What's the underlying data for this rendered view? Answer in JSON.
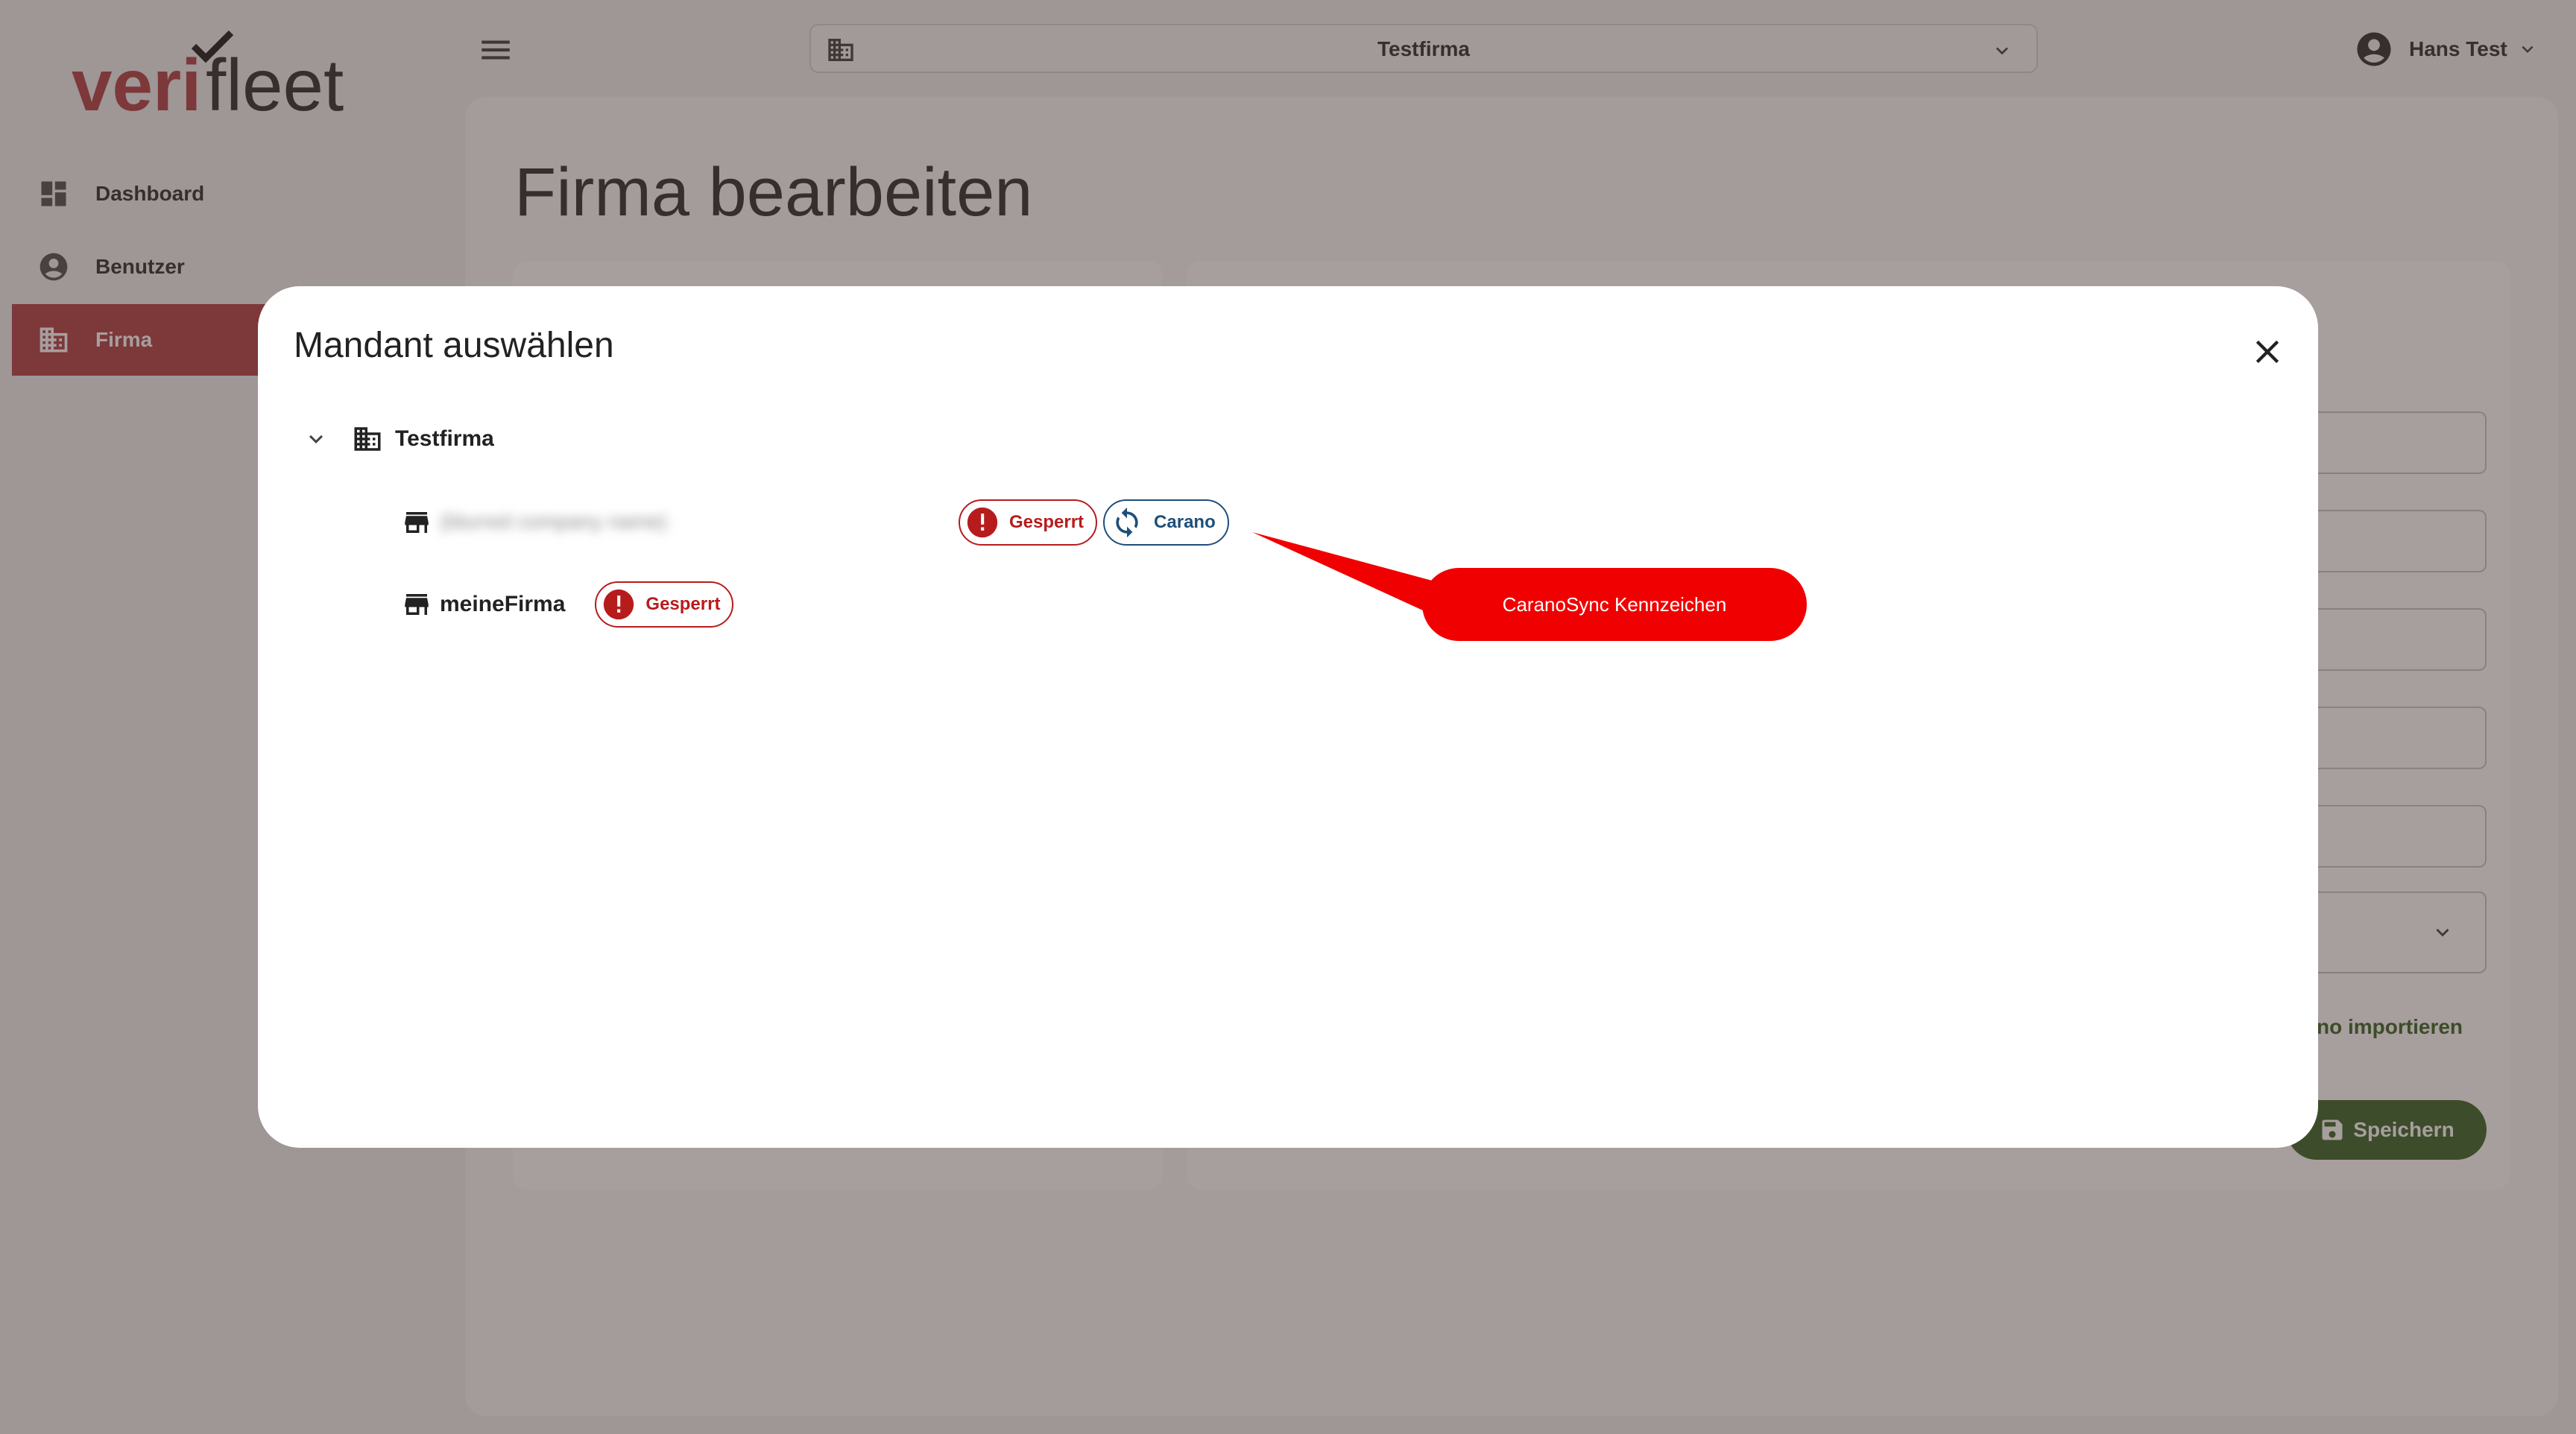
{
  "app": {
    "logo_text_left": "veri",
    "logo_text_right": "fleet",
    "brand_color": "#b3464a"
  },
  "sidebar": {
    "items": [
      {
        "label": "Dashboard",
        "icon": "dashboard-icon"
      },
      {
        "label": "Benutzer",
        "icon": "account-circle-icon"
      },
      {
        "label": "Firma",
        "icon": "building-icon",
        "active": true
      }
    ]
  },
  "header": {
    "tenant_name": "Testfirma",
    "user_name": "Hans Test"
  },
  "page": {
    "title": "Firma bearbeiten",
    "import_link": "no importieren",
    "save_label": "Speichern"
  },
  "modal": {
    "title": "Mandant auswählen",
    "tree": {
      "root_label": "Testfirma",
      "children": [
        {
          "label": "(blurred company name)",
          "badges": [
            "Gesperrt",
            "Carano"
          ]
        },
        {
          "label": "meineFirma",
          "badges": [
            "Gesperrt"
          ]
        }
      ]
    }
  },
  "badges": {
    "locked": "Gesperrt",
    "sync": "Carano",
    "locked_color": "#b71c1c",
    "sync_color": "#1e4f7a"
  },
  "annotation": {
    "text": "CaranoSync Kennzeichen",
    "color": "#f00000"
  }
}
